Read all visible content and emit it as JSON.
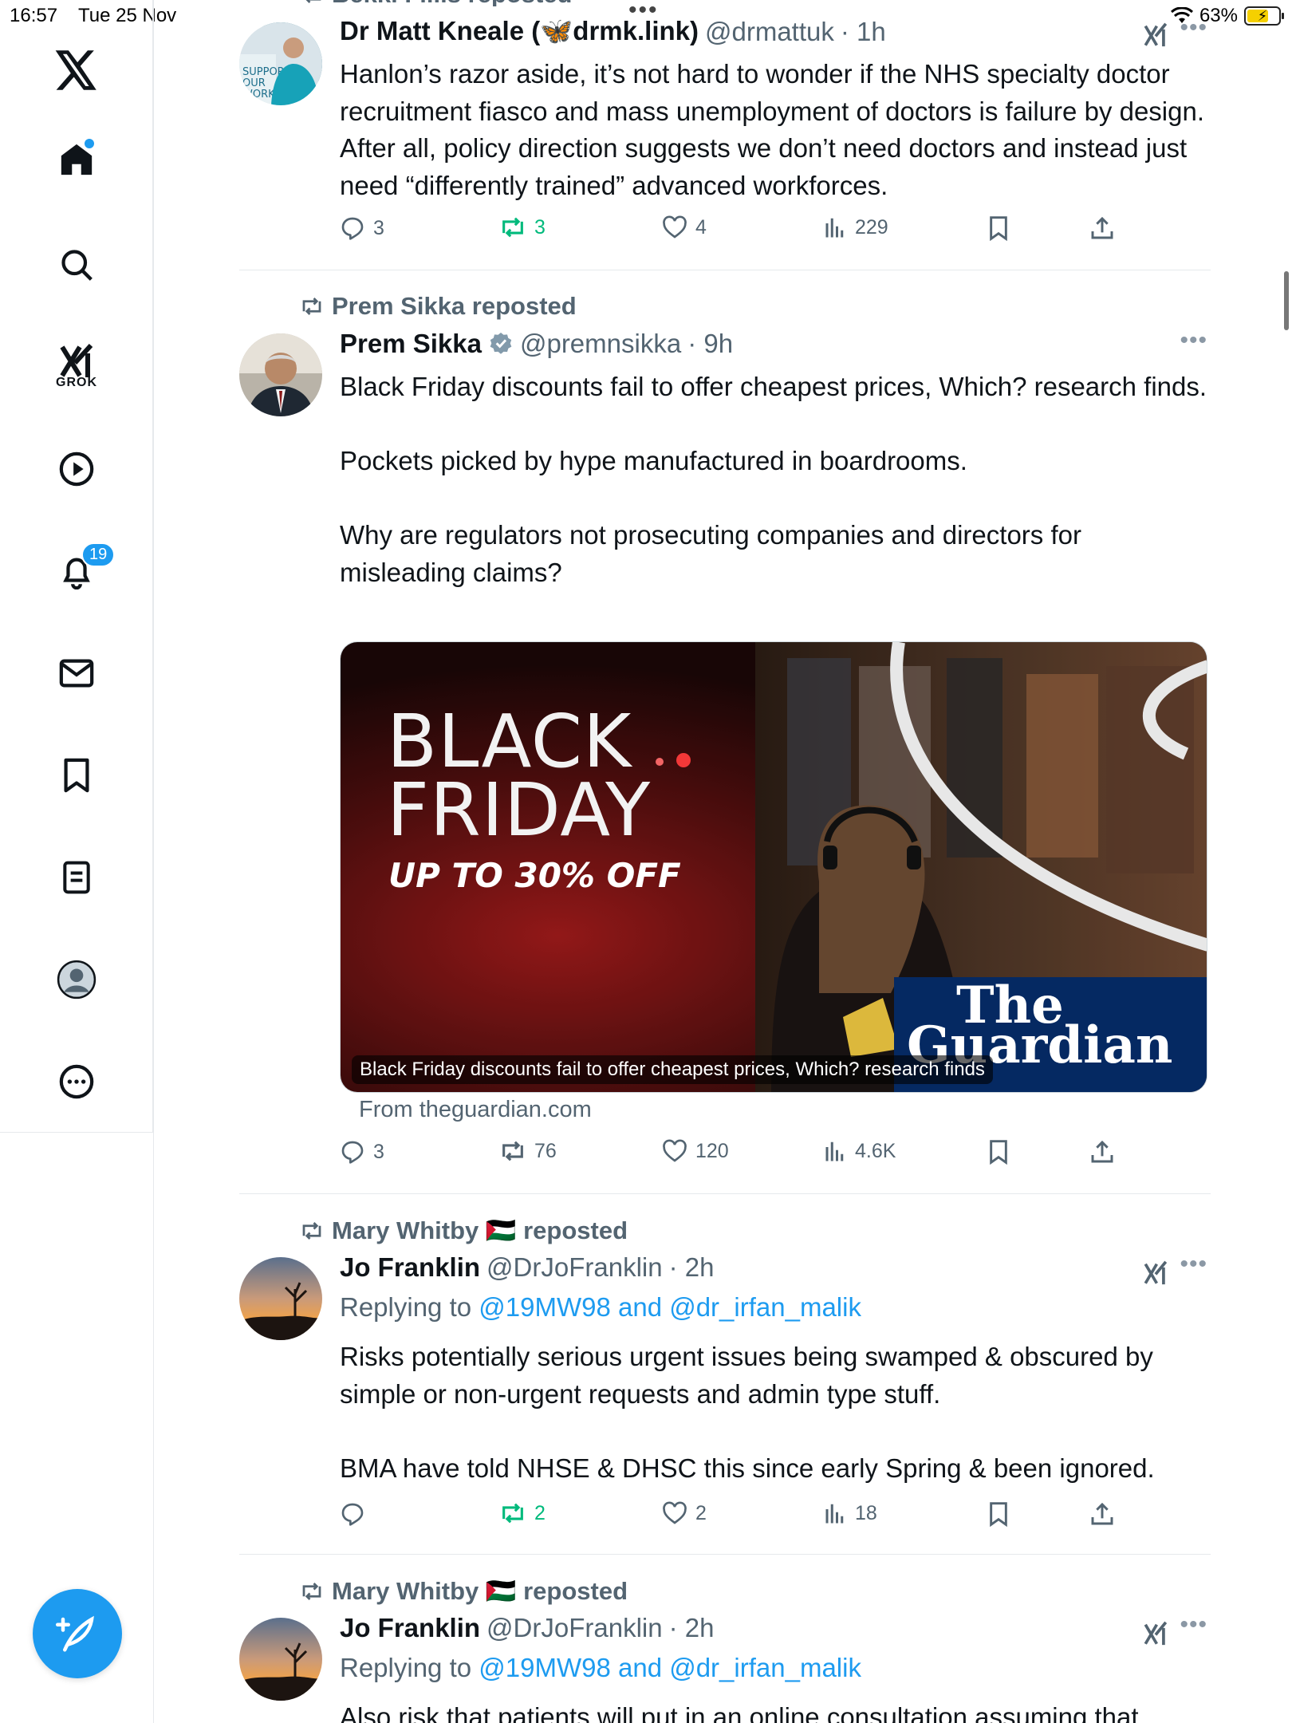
{
  "status_bar": {
    "time": "16:57",
    "date": "Tue 25 Nov",
    "battery": "63%"
  },
  "sidebar": {
    "grok_label": "GROK",
    "notification_count": "19"
  },
  "colors": {
    "accent": "#1d9bf0",
    "repost_green": "#00ba7c",
    "muted": "#536471"
  },
  "tweets": [
    {
      "repost_by": "Bekki Fillis reposted",
      "name": "Dr Matt Kneale (🦋drmk.link)",
      "handle": "@drmattuk",
      "time": "· 1h",
      "text": "Hanlon’s razor aside, it’s not hard to wonder if the NHS specialty doctor recruitment fiasco and mass unemployment of doctors is failure by design. After all, policy direction suggests we don’t need doctors and instead just need “differently trained” advanced workforces.",
      "replies": "3",
      "reposts": "3",
      "likes": "4",
      "views": "229"
    },
    {
      "repost_by": "Prem Sikka reposted",
      "name": "Prem Sikka",
      "handle": "@premnsikka",
      "time": "· 9h",
      "text": "Black Friday discounts fail to offer cheapest prices, Which? research finds.\n\nPockets picked by hype manufactured in boardrooms.\n\nWhy are regulators not prosecuting companies and directors for misleading claims?",
      "card": {
        "headline_big": "BLACK FRIDAY",
        "line1": "BLACK",
        "line2": "FRIDAY",
        "offer": "UP TO 30% OFF",
        "brand1": "The",
        "brand2": "Guardian",
        "caption": "Black Friday discounts fail to offer cheapest prices, Which? research finds",
        "source": "From theguardian.com"
      },
      "replies": "3",
      "reposts": "76",
      "likes": "120",
      "views": "4.6K"
    },
    {
      "repost_by": "Mary Whitby 🇵🇸 reposted",
      "name": "Jo Franklin",
      "handle": "@DrJoFranklin",
      "time": "· 2h",
      "reply_prefix": "Replying to ",
      "reply_targets": "@19MW98 and @dr_irfan_malik",
      "text": "Risks potentially serious urgent issues being swamped & obscured by simple or non-urgent requests and admin type stuff.\n\nBMA have told NHSE & DHSC this since early Spring & been ignored.",
      "replies": "",
      "reposts": "2",
      "likes": "2",
      "views": "18"
    },
    {
      "repost_by": "Mary Whitby 🇵🇸 reposted",
      "name": "Jo Franklin",
      "handle": "@DrJoFranklin",
      "time": "· 2h",
      "reply_prefix": "Replying to ",
      "reply_targets": "@19MW98 and @dr_irfan_malik",
      "text": "Also risk that patients will put in an online consultation assuming that"
    }
  ]
}
